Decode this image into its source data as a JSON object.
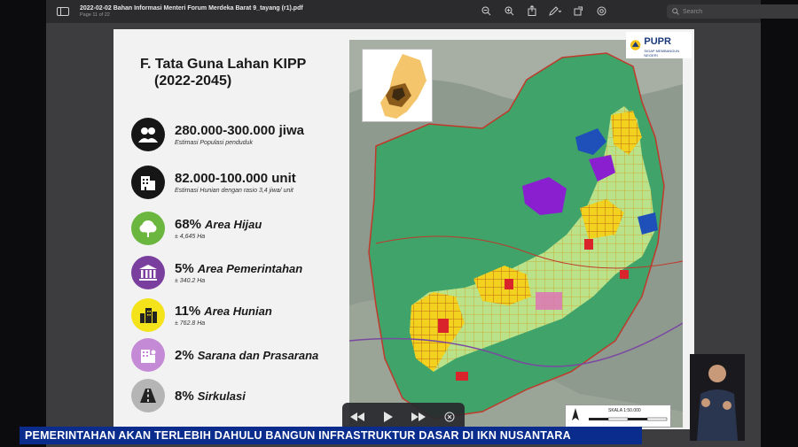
{
  "viewer": {
    "file_name": "2022-02-02 Bahan Informasi Menteri Forum Merdeka Barat 9_tayang (r1).pdf",
    "page_indicator": "Page 11 of 22",
    "search_placeholder": "Search",
    "icons": [
      "sidebar-icon",
      "zoom-out-icon",
      "zoom-in-icon",
      "share-icon",
      "markup-icon",
      "rotate-icon",
      "annotate-icon",
      "search-icon"
    ]
  },
  "slide": {
    "title_line1": "F. Tata Guna Lahan KIPP",
    "title_line2": "(2022-2045)",
    "stats": [
      {
        "value": "280.000-300.000 jiwa",
        "label": "",
        "note": "Estimasi Populasi penduduk",
        "icon": "people-icon",
        "color": "#161616"
      },
      {
        "value": "82.000-100.000 unit",
        "label": "",
        "note": "Estimasi Hunian dengan rasio 3,4 jiwa/ unit",
        "icon": "building-icon",
        "color": "#161616"
      },
      {
        "value": "68%",
        "label": "Area Hijau",
        "note": "± 4,645 Ha",
        "icon": "tree-icon",
        "color": "#6bb63e"
      },
      {
        "value": "5%",
        "label": "Area Pemerintahan",
        "note": "± 340.2 Ha",
        "icon": "government-icon",
        "color": "#7a3e9e"
      },
      {
        "value": "11%",
        "label": "Area Hunian",
        "note": "± 762.8 Ha",
        "icon": "housing-icon",
        "color": "#f4e21a"
      },
      {
        "value": "2%",
        "label": "Sarana dan Prasarana",
        "note": "",
        "icon": "facility-icon",
        "color": "#c58ad6"
      },
      {
        "value": "8%",
        "label": "Sirkulasi",
        "note": "",
        "icon": "road-icon",
        "color": "#b5b5b5"
      }
    ],
    "logo": {
      "brand": "PUPR",
      "tagline": "SIGAP MEMBANGUN NEGERI"
    },
    "scale": {
      "label": "SKALA 1:50.000"
    }
  },
  "ticker": {
    "text": "PEMERINTAHAN AKAN TERLEBIH DAHULU BANGUN INFRASTRUKTUR DASAR DI IKN NUSANTARA"
  },
  "colors": {
    "ticker_bg": "#0a2c8c",
    "green_zone": "#3fa36a",
    "light_green": "#b9e28a",
    "yellow_zone": "#f2d21e",
    "purple_zone": "#8a1fd0",
    "red_zone": "#d8242a",
    "blue_zone": "#1f4fb8"
  }
}
